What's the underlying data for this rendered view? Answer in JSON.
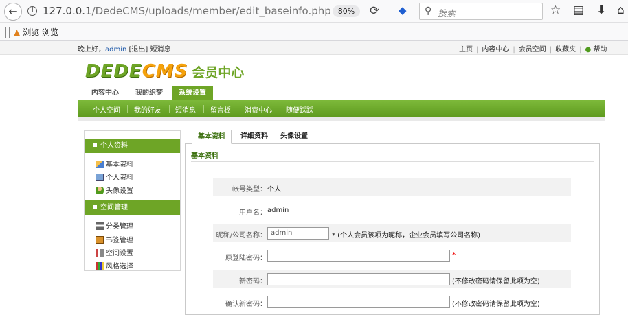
{
  "browser": {
    "url_prefix": "127.0.0.1",
    "url_path": "/DedeCMS/uploads/member/edit_baseinfo.php",
    "zoom": "80%",
    "search_placeholder": "搜索",
    "bookmark": "浏览 浏览"
  },
  "site": {
    "greeting_pre": "晚上好，",
    "username": "admin",
    "logout": "[退出]",
    "messages": "短消息",
    "top_links": [
      "主页",
      "内容中心",
      "会员空间",
      "收藏夹",
      "帮助"
    ]
  },
  "logo": {
    "part1": "DEDE",
    "part2": "CMS",
    "part3": "会员中心"
  },
  "main_tabs": [
    "内容中心",
    "我的织梦",
    "系统设置"
  ],
  "green_nav": [
    "个人空间",
    "我的好友",
    "短消息",
    "留言板",
    "消费中心",
    "随便踩踩"
  ],
  "sidebar": {
    "group1": {
      "title": "个人资料",
      "items": [
        "基本资料",
        "个人资料",
        "头像设置"
      ]
    },
    "group2": {
      "title": "空间管理",
      "items": [
        "分类管理",
        "书签管理",
        "空间设置",
        "风格选择"
      ]
    }
  },
  "content_tabs": [
    "基本资料",
    "详细资料",
    "头像设置"
  ],
  "panel_title": "基本资料",
  "form": {
    "account_type_label": "帐号类型：",
    "account_type_value": "个人",
    "username_label": "用户名：",
    "username_value": "admin",
    "nickname_label": "昵称/公司名称：",
    "nickname_value": "admin",
    "nickname_hint": "* (个人会员该项为昵称，企业会员填写公司名称)",
    "old_password_label": "原登陆密码：",
    "old_password_required": "*",
    "new_password_label": "新密码：",
    "new_password_hint": "(不修改密码请保留此项为空)",
    "confirm_password_label": "确认新密码：",
    "confirm_password_hint": "(不修改密码请保留此项为空)"
  },
  "colors": {
    "brand_green": "#6ea526",
    "logo_orange": "#f5a20b",
    "required_red": "#e00000"
  }
}
